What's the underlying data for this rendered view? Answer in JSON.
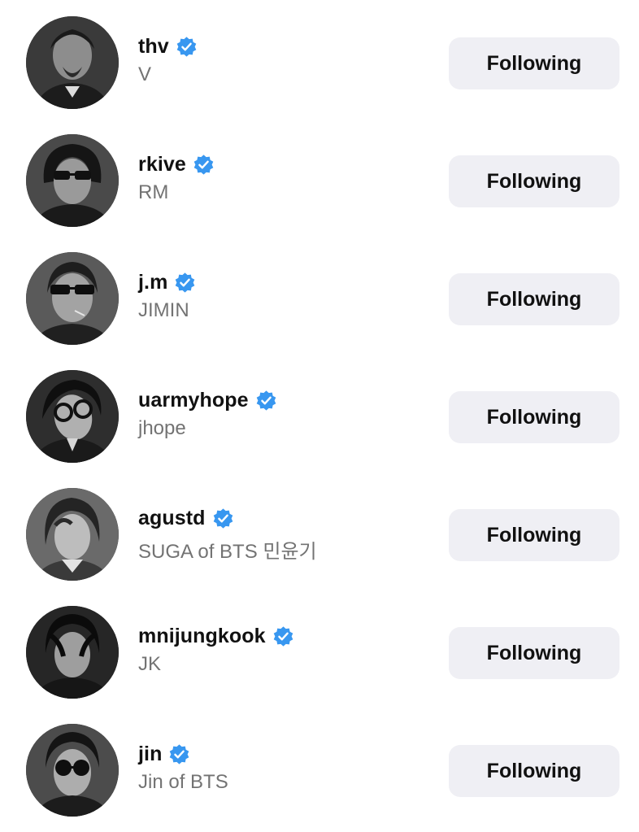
{
  "accounts": [
    {
      "username": "thv",
      "full_name": "V",
      "verified": true,
      "button_label": "Following",
      "avatar": "profile-photo"
    },
    {
      "username": "rkive",
      "full_name": "RM",
      "verified": true,
      "button_label": "Following",
      "avatar": "profile-photo"
    },
    {
      "username": "j.m",
      "full_name": "JIMIN",
      "verified": true,
      "button_label": "Following",
      "avatar": "profile-photo"
    },
    {
      "username": "uarmyhope",
      "full_name": "jhope",
      "verified": true,
      "button_label": "Following",
      "avatar": "profile-photo"
    },
    {
      "username": "agustd",
      "full_name": "SUGA of BTS 민윤기",
      "verified": true,
      "button_label": "Following",
      "avatar": "profile-photo"
    },
    {
      "username": "mnijungkook",
      "full_name": "JK",
      "verified": true,
      "button_label": "Following",
      "avatar": "profile-photo"
    },
    {
      "username": "jin",
      "full_name": "Jin of BTS",
      "verified": true,
      "button_label": "Following",
      "avatar": "profile-photo"
    }
  ],
  "colors": {
    "verified_badge": "#3897f0",
    "button_bg": "#efeff4",
    "secondary_text": "#737373"
  }
}
